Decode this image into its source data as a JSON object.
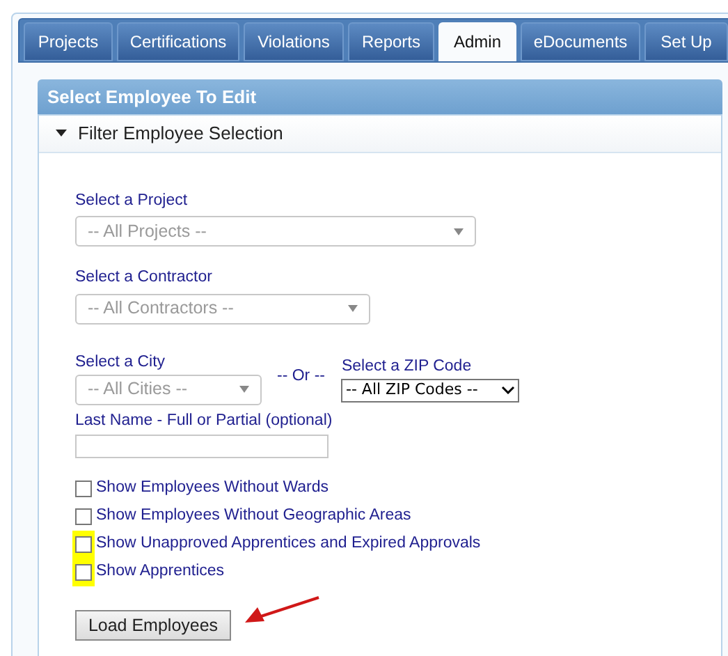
{
  "tabs": [
    {
      "label": "Projects",
      "selected": false
    },
    {
      "label": "Certifications",
      "selected": false
    },
    {
      "label": "Violations",
      "selected": false
    },
    {
      "label": "Reports",
      "selected": false
    },
    {
      "label": "Admin",
      "selected": true
    },
    {
      "label": "eDocuments",
      "selected": false
    },
    {
      "label": "Set Up",
      "selected": false
    }
  ],
  "panel": {
    "title": "Select Employee To Edit"
  },
  "filter": {
    "title": "Filter Employee Selection",
    "expanded": true
  },
  "project": {
    "label": "Select a Project",
    "value": "-- All Projects --"
  },
  "contractor": {
    "label": "Select a Contractor",
    "value": "-- All Contractors --"
  },
  "city": {
    "label": "Select a City",
    "value": "-- All Cities --"
  },
  "or_text": "-- Or --",
  "zip": {
    "label": "Select a ZIP Code",
    "value": "-- All ZIP Codes --"
  },
  "last_name": {
    "label": "Last Name - Full or Partial (optional)"
  },
  "options": [
    {
      "label": "Show Employees Without Wards",
      "checked": false,
      "highlighted": false
    },
    {
      "label": "Show Employees Without Geographic Areas",
      "checked": false,
      "highlighted": false
    },
    {
      "label": "Show Unapproved Apprentices and Expired Approvals",
      "checked": false,
      "highlighted": true
    },
    {
      "label": "Show Apprentices",
      "checked": false,
      "highlighted": true
    }
  ],
  "load_button": "Load Employees"
}
